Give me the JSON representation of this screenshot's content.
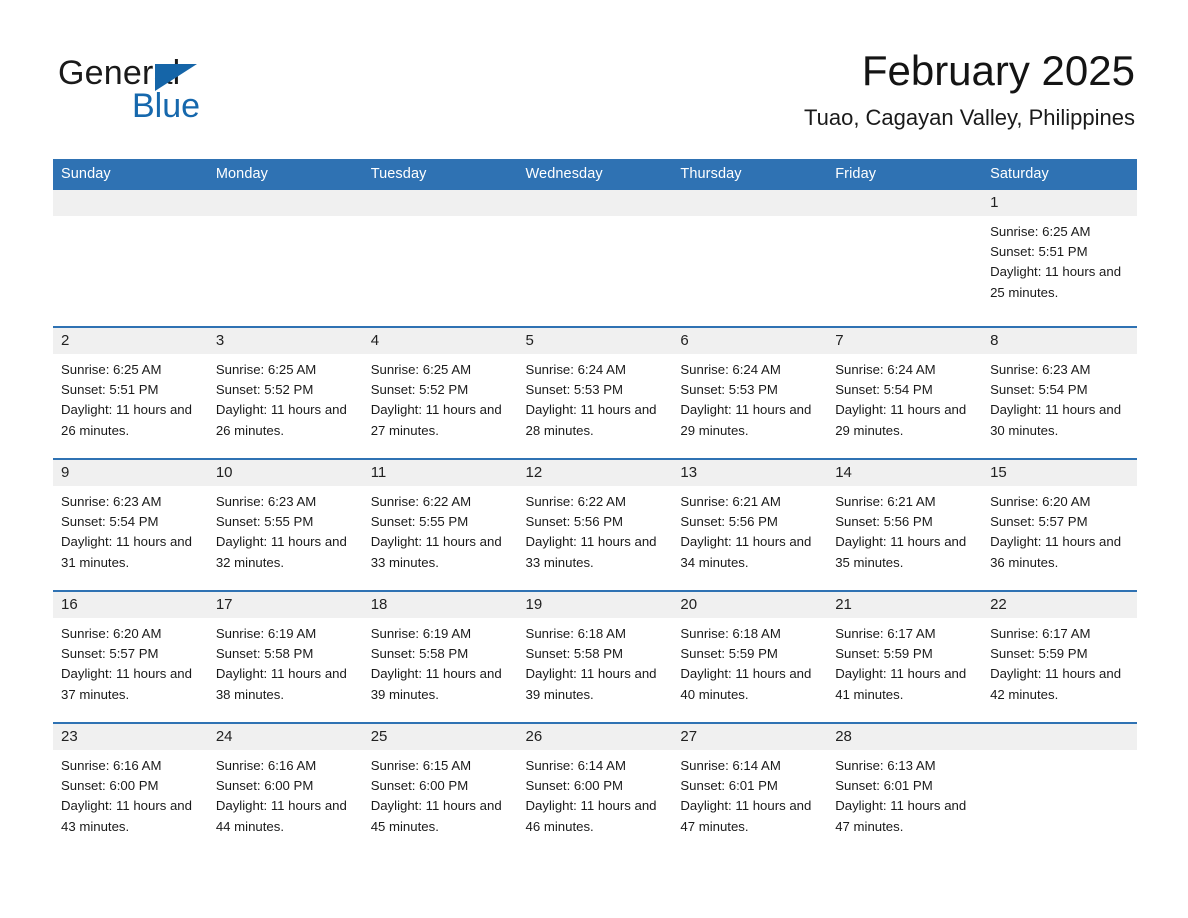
{
  "brand": {
    "word_one": "General",
    "word_two": "Blue",
    "accent_color": "#1668ad"
  },
  "header": {
    "title": "February 2025",
    "subtitle": "Tuao, Cagayan Valley, Philippines"
  },
  "calendar": {
    "header_bg": "#2f72b3",
    "daynum_bg": "#f0f0f0",
    "weekday_labels": [
      "Sunday",
      "Monday",
      "Tuesday",
      "Wednesday",
      "Thursday",
      "Friday",
      "Saturday"
    ],
    "weeks": [
      [
        {
          "day": "",
          "sunrise": "",
          "sunset": "",
          "daylight": ""
        },
        {
          "day": "",
          "sunrise": "",
          "sunset": "",
          "daylight": ""
        },
        {
          "day": "",
          "sunrise": "",
          "sunset": "",
          "daylight": ""
        },
        {
          "day": "",
          "sunrise": "",
          "sunset": "",
          "daylight": ""
        },
        {
          "day": "",
          "sunrise": "",
          "sunset": "",
          "daylight": ""
        },
        {
          "day": "",
          "sunrise": "",
          "sunset": "",
          "daylight": ""
        },
        {
          "day": "1",
          "sunrise": "Sunrise: 6:25 AM",
          "sunset": "Sunset: 5:51 PM",
          "daylight": "Daylight: 11 hours and 25 minutes."
        }
      ],
      [
        {
          "day": "2",
          "sunrise": "Sunrise: 6:25 AM",
          "sunset": "Sunset: 5:51 PM",
          "daylight": "Daylight: 11 hours and 26 minutes."
        },
        {
          "day": "3",
          "sunrise": "Sunrise: 6:25 AM",
          "sunset": "Sunset: 5:52 PM",
          "daylight": "Daylight: 11 hours and 26 minutes."
        },
        {
          "day": "4",
          "sunrise": "Sunrise: 6:25 AM",
          "sunset": "Sunset: 5:52 PM",
          "daylight": "Daylight: 11 hours and 27 minutes."
        },
        {
          "day": "5",
          "sunrise": "Sunrise: 6:24 AM",
          "sunset": "Sunset: 5:53 PM",
          "daylight": "Daylight: 11 hours and 28 minutes."
        },
        {
          "day": "6",
          "sunrise": "Sunrise: 6:24 AM",
          "sunset": "Sunset: 5:53 PM",
          "daylight": "Daylight: 11 hours and 29 minutes."
        },
        {
          "day": "7",
          "sunrise": "Sunrise: 6:24 AM",
          "sunset": "Sunset: 5:54 PM",
          "daylight": "Daylight: 11 hours and 29 minutes."
        },
        {
          "day": "8",
          "sunrise": "Sunrise: 6:23 AM",
          "sunset": "Sunset: 5:54 PM",
          "daylight": "Daylight: 11 hours and 30 minutes."
        }
      ],
      [
        {
          "day": "9",
          "sunrise": "Sunrise: 6:23 AM",
          "sunset": "Sunset: 5:54 PM",
          "daylight": "Daylight: 11 hours and 31 minutes."
        },
        {
          "day": "10",
          "sunrise": "Sunrise: 6:23 AM",
          "sunset": "Sunset: 5:55 PM",
          "daylight": "Daylight: 11 hours and 32 minutes."
        },
        {
          "day": "11",
          "sunrise": "Sunrise: 6:22 AM",
          "sunset": "Sunset: 5:55 PM",
          "daylight": "Daylight: 11 hours and 33 minutes."
        },
        {
          "day": "12",
          "sunrise": "Sunrise: 6:22 AM",
          "sunset": "Sunset: 5:56 PM",
          "daylight": "Daylight: 11 hours and 33 minutes."
        },
        {
          "day": "13",
          "sunrise": "Sunrise: 6:21 AM",
          "sunset": "Sunset: 5:56 PM",
          "daylight": "Daylight: 11 hours and 34 minutes."
        },
        {
          "day": "14",
          "sunrise": "Sunrise: 6:21 AM",
          "sunset": "Sunset: 5:56 PM",
          "daylight": "Daylight: 11 hours and 35 minutes."
        },
        {
          "day": "15",
          "sunrise": "Sunrise: 6:20 AM",
          "sunset": "Sunset: 5:57 PM",
          "daylight": "Daylight: 11 hours and 36 minutes."
        }
      ],
      [
        {
          "day": "16",
          "sunrise": "Sunrise: 6:20 AM",
          "sunset": "Sunset: 5:57 PM",
          "daylight": "Daylight: 11 hours and 37 minutes."
        },
        {
          "day": "17",
          "sunrise": "Sunrise: 6:19 AM",
          "sunset": "Sunset: 5:58 PM",
          "daylight": "Daylight: 11 hours and 38 minutes."
        },
        {
          "day": "18",
          "sunrise": "Sunrise: 6:19 AM",
          "sunset": "Sunset: 5:58 PM",
          "daylight": "Daylight: 11 hours and 39 minutes."
        },
        {
          "day": "19",
          "sunrise": "Sunrise: 6:18 AM",
          "sunset": "Sunset: 5:58 PM",
          "daylight": "Daylight: 11 hours and 39 minutes."
        },
        {
          "day": "20",
          "sunrise": "Sunrise: 6:18 AM",
          "sunset": "Sunset: 5:59 PM",
          "daylight": "Daylight: 11 hours and 40 minutes."
        },
        {
          "day": "21",
          "sunrise": "Sunrise: 6:17 AM",
          "sunset": "Sunset: 5:59 PM",
          "daylight": "Daylight: 11 hours and 41 minutes."
        },
        {
          "day": "22",
          "sunrise": "Sunrise: 6:17 AM",
          "sunset": "Sunset: 5:59 PM",
          "daylight": "Daylight: 11 hours and 42 minutes."
        }
      ],
      [
        {
          "day": "23",
          "sunrise": "Sunrise: 6:16 AM",
          "sunset": "Sunset: 6:00 PM",
          "daylight": "Daylight: 11 hours and 43 minutes."
        },
        {
          "day": "24",
          "sunrise": "Sunrise: 6:16 AM",
          "sunset": "Sunset: 6:00 PM",
          "daylight": "Daylight: 11 hours and 44 minutes."
        },
        {
          "day": "25",
          "sunrise": "Sunrise: 6:15 AM",
          "sunset": "Sunset: 6:00 PM",
          "daylight": "Daylight: 11 hours and 45 minutes."
        },
        {
          "day": "26",
          "sunrise": "Sunrise: 6:14 AM",
          "sunset": "Sunset: 6:00 PM",
          "daylight": "Daylight: 11 hours and 46 minutes."
        },
        {
          "day": "27",
          "sunrise": "Sunrise: 6:14 AM",
          "sunset": "Sunset: 6:01 PM",
          "daylight": "Daylight: 11 hours and 47 minutes."
        },
        {
          "day": "28",
          "sunrise": "Sunrise: 6:13 AM",
          "sunset": "Sunset: 6:01 PM",
          "daylight": "Daylight: 11 hours and 47 minutes."
        },
        {
          "day": "",
          "sunrise": "",
          "sunset": "",
          "daylight": ""
        }
      ]
    ]
  }
}
